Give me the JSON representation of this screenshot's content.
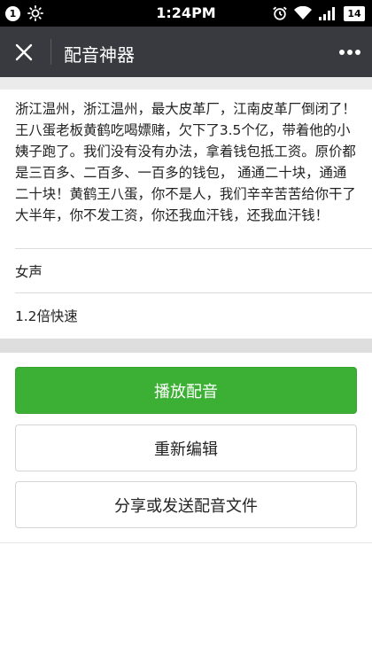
{
  "status_bar": {
    "notification_count": "1",
    "time": "1:24PM",
    "battery": "14",
    "icons": [
      "brightness-icon",
      "alarm-icon",
      "wifi-icon",
      "signal-icon",
      "battery-icon"
    ]
  },
  "nav": {
    "title": "配音神器",
    "close_icon": "close-icon",
    "more_icon": "more-icon"
  },
  "content": {
    "script_text": "浙江温州，浙江温州，最大皮革厂，江南皮革厂倒闭了！王八蛋老板黄鹤吃喝嫖赌，欠下了3.5个亿，带着他的小姨子跑了。我们没有没有办法，拿着钱包抵工资。原价都是三百多、二百多、一百多的钱包， 通通二十块，通通二十块！黄鹤王八蛋，你不是人，我们辛辛苦苦给你干了大半年，你不发工资，你还我血汗钱，还我血汗钱！",
    "voice": "女声",
    "speed": "1.2倍快速"
  },
  "actions": {
    "play_label": "播放配音",
    "edit_label": "重新编辑",
    "share_label": "分享或发送配音文件"
  },
  "colors": {
    "nav_bg": "#393a3f",
    "primary_green": "#3cb034",
    "page_gray": "#ebebeb"
  }
}
